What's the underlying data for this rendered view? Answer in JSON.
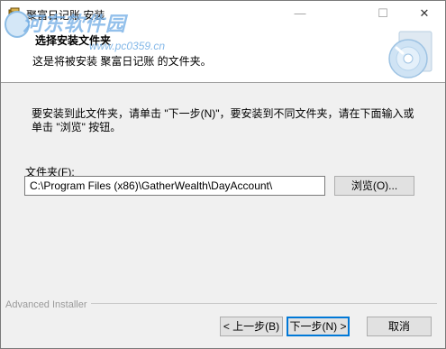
{
  "window": {
    "title": "聚富日记账 安装",
    "controls": {
      "minimize": "—",
      "maximize": "☐",
      "close": "✕"
    }
  },
  "watermark": {
    "main": "河东软件园",
    "sub": "www.pc0359.cn"
  },
  "header": {
    "title": "选择安装文件夹",
    "subtitle": "这是将被安装 聚富日记账 的文件夹。"
  },
  "main": {
    "instructions": "要安装到此文件夹，请单击 \"下一步(N)\"，要安装到不同文件夹，请在下面输入或单击 \"浏览\" 按钮。",
    "folder_label": "文件夹(F):",
    "folder_value": "C:\\Program Files (x86)\\GatherWealth\\DayAccount\\",
    "browse_label": "浏览(O)..."
  },
  "footer": {
    "brand": "Advanced Installer",
    "back_label": "< 上一步(B)",
    "next_label": "下一步(N) >",
    "cancel_label": "取消"
  }
}
